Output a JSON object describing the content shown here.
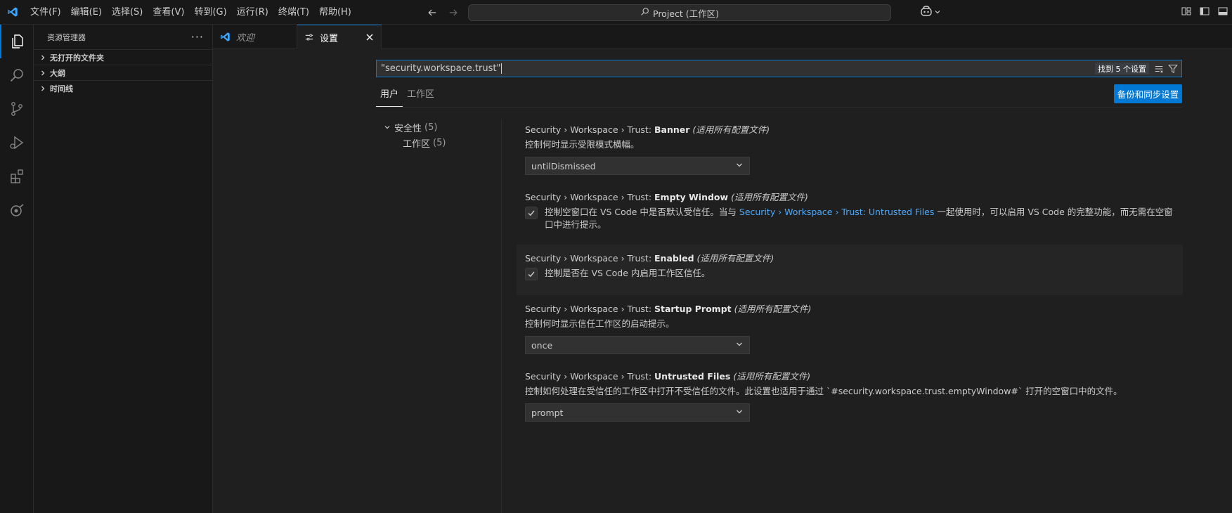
{
  "titlebar": {
    "menus": [
      "文件(F)",
      "编辑(E)",
      "选择(S)",
      "查看(V)",
      "转到(G)",
      "运行(R)",
      "终端(T)",
      "帮助(H)"
    ],
    "search_text": "Project (工作区)"
  },
  "sidebar": {
    "title": "资源管理器",
    "sections": [
      "无打开的文件夹",
      "大纲",
      "时间线"
    ]
  },
  "tabs": [
    {
      "label": "欢迎"
    },
    {
      "label": "设置"
    }
  ],
  "settings_editor": {
    "search_value": "\"security.workspace.trust\"",
    "result_count": "找到 5 个设置",
    "scope_tabs": [
      "用户",
      "工作区"
    ],
    "sync_button": "备份和同步设置",
    "toc": {
      "group": "安全性",
      "group_count": "(5)",
      "child": "工作区",
      "child_count": "(5)"
    },
    "items": [
      {
        "prefix": "Security › Workspace › Trust: ",
        "name": "Banner",
        "scope": "(适用所有配置文件)",
        "description": "控制何时显示受限模式横幅。",
        "value": "untilDismissed"
      },
      {
        "prefix": "Security › Workspace › Trust: ",
        "name": "Empty Window",
        "scope": "(适用所有配置文件)",
        "desc_before": "控制空窗口在 VS Code 中是否默认受信任。当与 ",
        "desc_link": "Security › Workspace › Trust: Untrusted Files",
        "desc_after": " 一起使用时，可以启用 VS Code 的完整功能，而无需在空窗口中进行提示。"
      },
      {
        "prefix": "Security › Workspace › Trust: ",
        "name": "Enabled",
        "scope": "(适用所有配置文件)",
        "description": "控制是否在 VS Code 内启用工作区信任。"
      },
      {
        "prefix": "Security › Workspace › Trust: ",
        "name": "Startup Prompt",
        "scope": "(适用所有配置文件)",
        "description": "控制何时显示信任工作区的启动提示。",
        "value": "once"
      },
      {
        "prefix": "Security › Workspace › Trust: ",
        "name": "Untrusted Files",
        "scope": "(适用所有配置文件)",
        "description": "控制如何处理在受信任的工作区中打开不受信任的文件。此设置也适用于通过 `#security.workspace.trust.emptyWindow#` 打开的空窗口中的文件。",
        "value": "prompt"
      }
    ]
  },
  "colors": {
    "accent": "#0078d4",
    "link": "#4daafc",
    "background": "#1f1f1f"
  }
}
